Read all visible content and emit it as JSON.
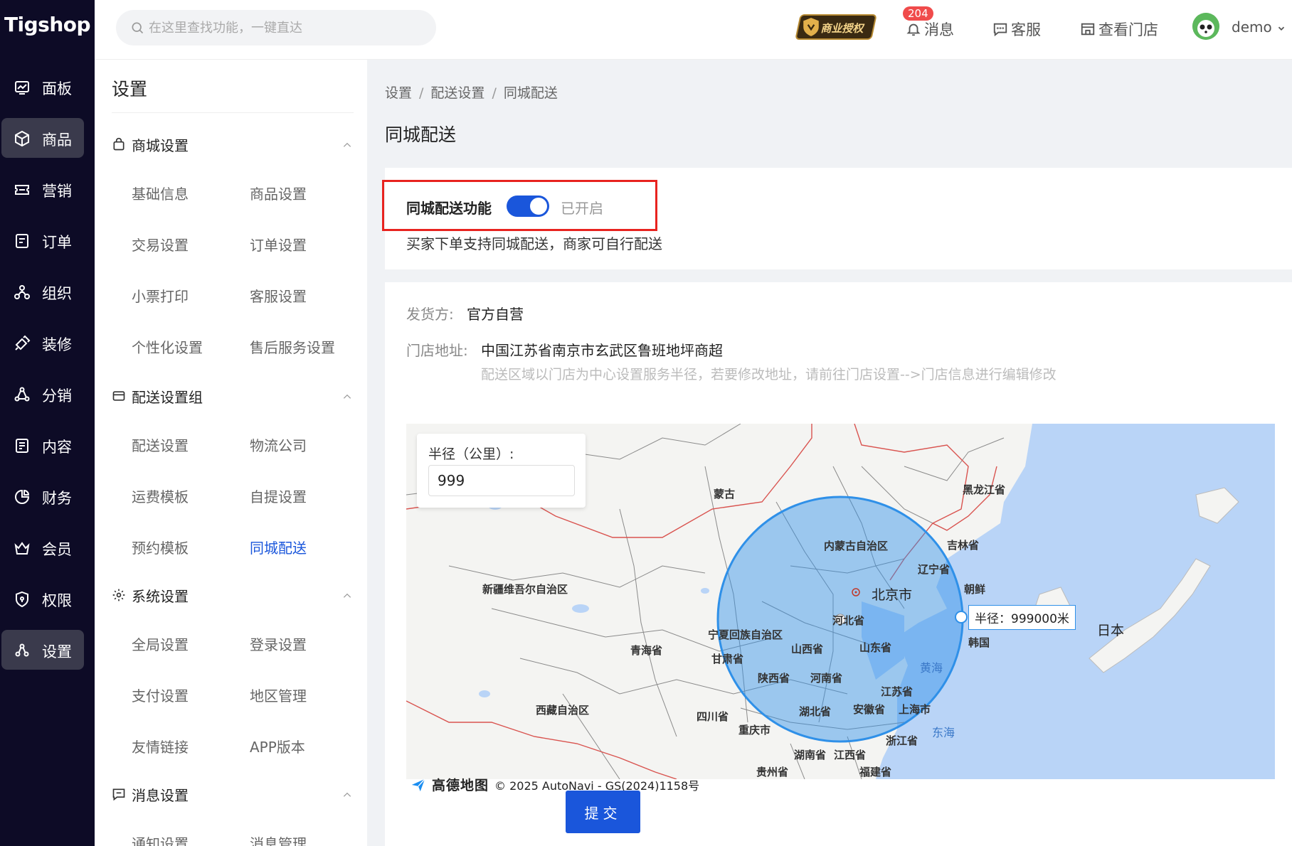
{
  "app": {
    "logo": "Tigshop"
  },
  "nav": {
    "items": [
      {
        "label": "面板",
        "icon": "dashboard-icon"
      },
      {
        "label": "商品",
        "icon": "cube-icon",
        "active": true
      },
      {
        "label": "营销",
        "icon": "ticket-icon"
      },
      {
        "label": "订单",
        "icon": "order-icon"
      },
      {
        "label": "组织",
        "icon": "org-icon"
      },
      {
        "label": "装修",
        "icon": "paint-icon"
      },
      {
        "label": "分销",
        "icon": "share-icon"
      },
      {
        "label": "内容",
        "icon": "content-icon"
      },
      {
        "label": "财务",
        "icon": "finance-icon"
      },
      {
        "label": "会员",
        "icon": "crown-icon"
      },
      {
        "label": "权限",
        "icon": "shield-icon"
      },
      {
        "label": "设置",
        "icon": "settings-icon",
        "active": true
      }
    ]
  },
  "header": {
    "search_placeholder": "在这里查找功能，一键直达",
    "auth_badge": "商业授权",
    "message_label": "消息",
    "message_count": "204",
    "service_label": "客服",
    "store_label": "查看门店",
    "user_name": "demo"
  },
  "sub": {
    "title": "设置",
    "groups": [
      {
        "label": "商城设置",
        "items": [
          "基础信息",
          "商品设置",
          "交易设置",
          "订单设置",
          "小票打印",
          "客服设置",
          "个性化设置",
          "售后服务设置"
        ]
      },
      {
        "label": "配送设置组",
        "items": [
          "配送设置",
          "物流公司",
          "运费模板",
          "自提设置",
          "预约模板",
          "同城配送"
        ]
      },
      {
        "label": "系统设置",
        "items": [
          "全局设置",
          "登录设置",
          "支付设置",
          "地区管理",
          "友情链接",
          "APP版本"
        ]
      },
      {
        "label": "消息设置",
        "items": [
          "通知设置",
          "消息管理"
        ]
      }
    ],
    "active_item": "同城配送"
  },
  "breadcrumb": [
    "设置",
    "配送设置",
    "同城配送"
  ],
  "page_title": "同城配送",
  "switch": {
    "label": "同城配送功能",
    "state": "已开启",
    "on": true,
    "desc": "买家下单支持同城配送，商家可自行配送"
  },
  "info": {
    "shipper_label": "发货方:",
    "shipper_value": "官方自营",
    "address_label": "门店地址:",
    "address_value": "中国江苏省南京市玄武区鲁班地坪商超",
    "hint": "配送区域以门店为中心设置服务半径，若要修改地址，请前往门店设置-->门店信息进行编辑修改"
  },
  "map": {
    "radius_label": "半径（公里）:",
    "radius_value": "999",
    "radius_tag": "半径：999000米",
    "labels": [
      "蒙古",
      "黑龙江省",
      "吉林省",
      "内蒙古自治区",
      "辽宁省",
      "朝鲜",
      "北京市",
      "新疆维吾尔自治区",
      "河北省",
      "韩国",
      "宁夏回族自治区",
      "山西省",
      "山东省",
      "甘肃省",
      "青海省",
      "日本",
      "黄海",
      "陕西省",
      "河南省",
      "江苏省",
      "西藏自治区",
      "四川省",
      "湖北省",
      "安徽省",
      "上海市",
      "重庆市",
      "东海",
      "浙江省",
      "湖南省",
      "江西省",
      "贵州省",
      "福建省"
    ],
    "attribution_brand": "高德地图",
    "attribution": "© 2025 AutoNavi - GS(2024)1158号",
    "circle_color": "#2f90e8"
  },
  "submit_label": "提交"
}
